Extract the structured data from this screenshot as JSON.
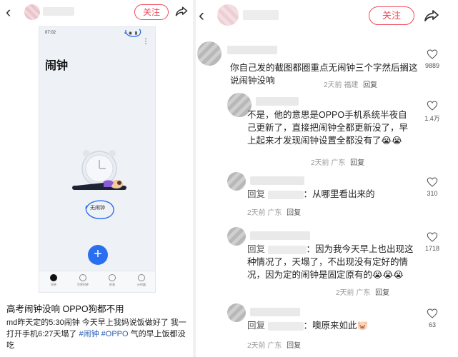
{
  "left": {
    "follow_label": "关注",
    "phone": {
      "time": "07:02",
      "status": "▪ ◉ ▮",
      "title": "闹钟",
      "empty_text": "无闹钟",
      "add_label": "+",
      "nav": [
        "闹钟",
        "世界时钟",
        "秒表",
        "计时器"
      ]
    },
    "post_title": "高考闹钟没响 OPPO狗都不用",
    "post_body_prefix": "md昨天定的5:30闹钟 今天早上我妈说饭做好了 我一打开手机6:27天塌了 ",
    "tag1": "#闹钟",
    "tag2": "#OPPO",
    "post_body_suffix": " 气的早上饭都没吃"
  },
  "right": {
    "follow_label": "关注",
    "comments": [
      {
        "text": "你自己发的截图都圈重点无闹钟三个字然后搁这说闹钟没响",
        "time": "2天前",
        "location": "福建",
        "reply": "回复",
        "likes": "9889"
      },
      {
        "text": "不是，他的意思是OPPO手机系统半夜自己更新了，直接把闹钟全都更新没了，早上起来才发现闹钟设置全都没有了😭😭",
        "time": "2天前",
        "location": "广东",
        "reply": "回复",
        "likes": "1.4万"
      },
      {
        "reply_kw": "回复",
        "text": "：从哪里看出来的",
        "time": "2天前",
        "location": "广东",
        "reply": "回复",
        "likes": "310"
      },
      {
        "reply_kw": "回复",
        "text": "：因为我今天早上也出现这种情况了，天塌了，不出现没有定好的情况，因为定的闹钟是固定原有的😭😭😭",
        "time": "2天前",
        "location": "广东",
        "reply": "回复",
        "likes": "1718"
      },
      {
        "reply_kw": "回复",
        "text": "：噢原来如此🐷",
        "time": "2天前",
        "location": "广东",
        "reply": "回复",
        "likes": "63"
      }
    ]
  },
  "colors": {
    "accent": "#f04a5a",
    "fab": "#2a6ff0",
    "tag": "#2a5db0"
  }
}
